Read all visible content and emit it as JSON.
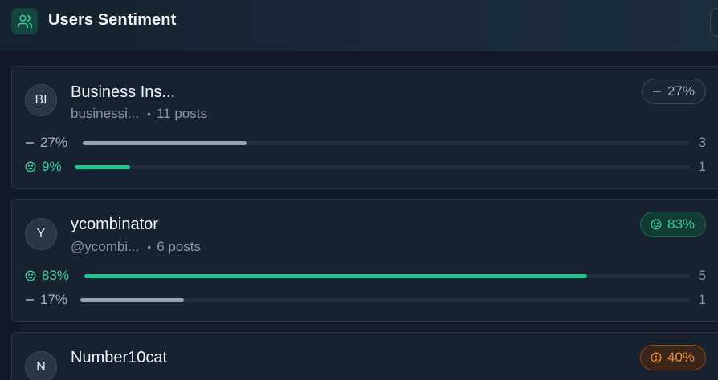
{
  "header": {
    "title": "Users Sentiment",
    "icon": "users-icon"
  },
  "colors": {
    "positive": "#19c98d",
    "neutral": "#9aa3ae",
    "warning": "#f08a2c"
  },
  "users": [
    {
      "initials": "BI",
      "name": "Business Ins...",
      "handle": "businessi...",
      "posts": "11 posts",
      "badge": {
        "kind": "neutral",
        "icon": "minus-icon",
        "text": "27%"
      },
      "rows": [
        {
          "kind": "neutral",
          "icon": "minus-icon",
          "percent": "27%",
          "fraction": 0.27,
          "count": "3"
        },
        {
          "kind": "positive",
          "icon": "smile-icon",
          "percent": "9%",
          "fraction": 0.09,
          "count": "1"
        }
      ]
    },
    {
      "initials": "Y",
      "name": "ycombinator",
      "handle": "@ycombi...",
      "posts": "6 posts",
      "badge": {
        "kind": "positive",
        "icon": "smile-icon",
        "text": "83%"
      },
      "rows": [
        {
          "kind": "positive",
          "icon": "smile-icon",
          "percent": "83%",
          "fraction": 0.83,
          "count": "5"
        },
        {
          "kind": "neutral",
          "icon": "minus-icon",
          "percent": "17%",
          "fraction": 0.17,
          "count": "1"
        }
      ]
    },
    {
      "initials": "N",
      "name": "Number10cat",
      "badge": {
        "kind": "warning",
        "icon": "alert-circle-icon",
        "text": "40%"
      }
    }
  ]
}
